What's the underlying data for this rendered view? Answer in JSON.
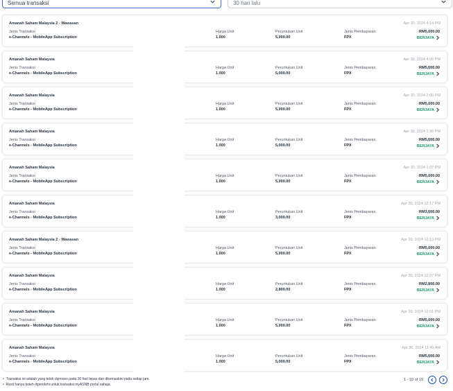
{
  "filters": {
    "type_value": "Semua transaksi",
    "period_value": "30 hari lalu"
  },
  "labels": {
    "type": "Jenis Transaksi",
    "price": "Harga Unit",
    "units": "Peruntukan Unit",
    "payment": "Jenis Pembayaran"
  },
  "transactions": [
    {
      "fund": "Amanah Saham Malaysia 2 - Wawasan",
      "date": "Apr 30, 2024 4:14 PM",
      "type": "e-Channels - MobileApp Subscription",
      "price": "1.000",
      "units": "5,000.00",
      "payment": "FPX",
      "amount": "RM5,000.00",
      "status": "BERJAYA"
    },
    {
      "fund": "Amanah Saham Malaysia",
      "date": "Apr 30, 2024 4:06 PM",
      "type": "e-Channels - MobileApp Subscription",
      "price": "1.000",
      "units": "5,000.00",
      "payment": "FPX",
      "amount": "RM5,000.00",
      "status": "BERJAYA"
    },
    {
      "fund": "Amanah Saham Malaysia",
      "date": "Apr 30, 2024 2:00 PM",
      "type": "e-Channels - MobileApp Subscription",
      "price": "1.000",
      "units": "5,000.00",
      "payment": "FPX",
      "amount": "RM5,000.00",
      "status": "BERJAYA"
    },
    {
      "fund": "Amanah Saham Malaysia",
      "date": "Apr 30, 2024 1:36 PM",
      "type": "e-Channels - MobileApp Subscription",
      "price": "1.000",
      "units": "5,000.00",
      "payment": "FPX",
      "amount": "RM5,000.00",
      "status": "BERJAYA"
    },
    {
      "fund": "Amanah Saham Malaysia",
      "date": "Apr 30, 2024 1:07 PM",
      "type": "e-Channels - MobileApp Subscription",
      "price": "1.000",
      "units": "5,000.00",
      "payment": "FPX",
      "amount": "RM5,000.00",
      "status": "BERJAYA"
    },
    {
      "fund": "Amanah Saham Malaysia",
      "date": "Apr 30, 2024 12:17 PM",
      "type": "e-Channels - MobileApp Subscription",
      "price": "1.000",
      "units": "3,000.00",
      "payment": "FPX",
      "amount": "RM3,000.00",
      "status": "BERJAYA"
    },
    {
      "fund": "Amanah Saham Malaysia 2 - Wawasan",
      "date": "Apr 30, 2024 12:13 PM",
      "type": "e-Channels - MobileApp Subscription",
      "price": "1.000",
      "units": "5,000.00",
      "payment": "FPX",
      "amount": "RM5,000.00",
      "status": "BERJAYA"
    },
    {
      "fund": "Amanah Saham Malaysia",
      "date": "Apr 30, 2024 12:07 PM",
      "type": "e-Channels - MobileApp Subscription",
      "price": "1.000",
      "units": "2,800.00",
      "payment": "FPX",
      "amount": "RM2,800.00",
      "status": "BERJAYA"
    },
    {
      "fund": "Amanah Saham Malaysia",
      "date": "Apr 30, 2024 12:01 PM",
      "type": "e-Channels - MobileApp Subscription",
      "price": "1.000",
      "units": "5,000.00",
      "payment": "FPX",
      "amount": "RM5,000.00",
      "status": "BERJAYA"
    },
    {
      "fund": "Amanah Saham Malaysia",
      "date": "Apr 30, 2024 11:49 AM",
      "type": "e-Channels - MobileApp Subscription",
      "price": "1.000",
      "units": "5,000.00",
      "payment": "FPX",
      "amount": "RM5,000.00",
      "status": "BERJAYA"
    }
  ],
  "footer": {
    "note1": "Transaksi ini adalah yang telah diproses pada 30 hari lepas dan dikemaskini pada setiap jam.",
    "note2": "Resit hanya boleh diperolehi untuk transaksi myASNB portal sahaja.",
    "pagination": "1 - 10 of 19"
  },
  "colors": {
    "accent": "#1f4fa8",
    "success": "#1f9a6a"
  },
  "icons": {
    "dropdown": "chevron-down-icon",
    "status_arrow": "chevron-right-icon",
    "prev": "chevron-left-icon",
    "next": "chevron-right-icon"
  }
}
